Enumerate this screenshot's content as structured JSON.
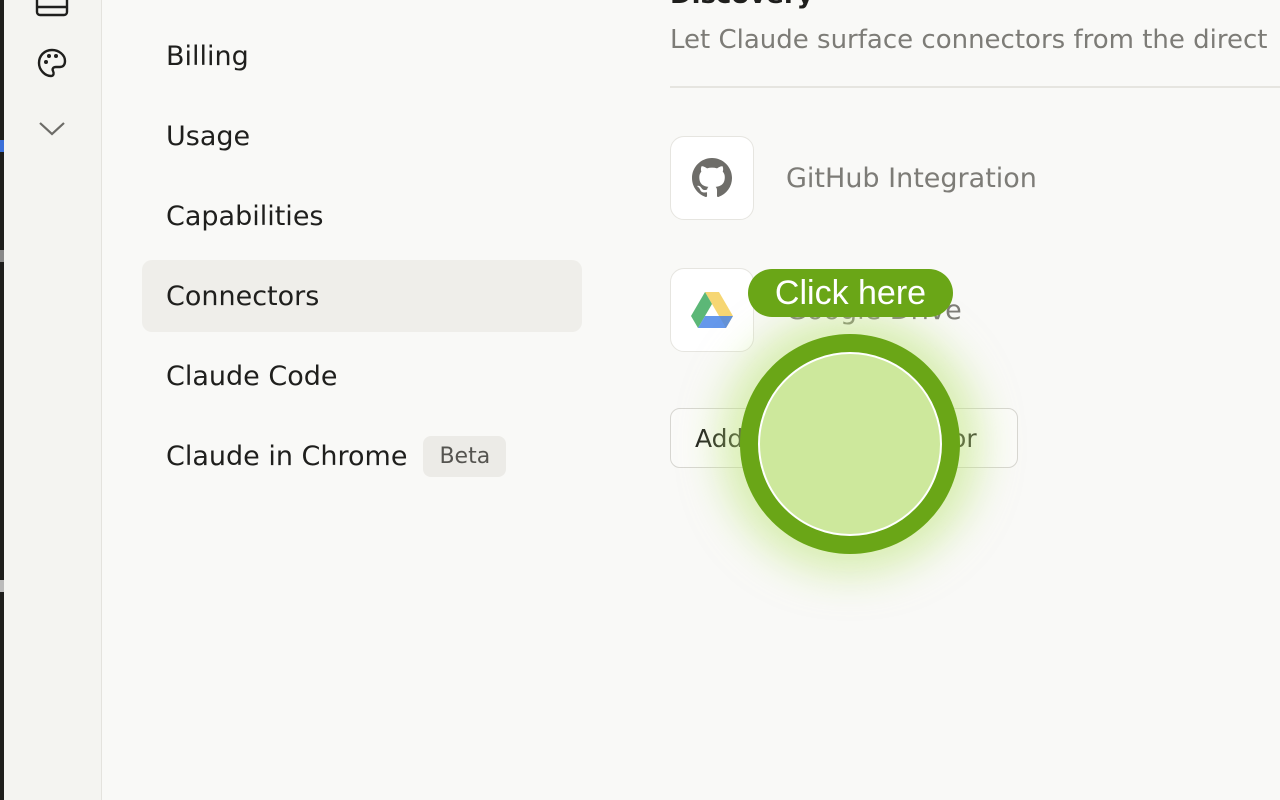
{
  "nav": {
    "items": [
      {
        "label": "Billing"
      },
      {
        "label": "Usage"
      },
      {
        "label": "Capabilities"
      },
      {
        "label": "Connectors"
      },
      {
        "label": "Claude Code"
      },
      {
        "label": "Claude in Chrome",
        "badge": "Beta"
      }
    ],
    "active": "Connectors"
  },
  "main": {
    "section_title": "Discovery",
    "section_description": "Let Claude surface connectors from the direct",
    "connectors": [
      {
        "name": "GitHub Integration",
        "icon": "github-icon"
      },
      {
        "name": "Google Drive",
        "icon": "google-drive-icon"
      }
    ],
    "add_button_label": "Add custom connector"
  },
  "overlay": {
    "hint_label": "Click here"
  },
  "colors": {
    "background": "#f9f9f7",
    "active_nav": "#efeeea",
    "hint_green": "#6aa617",
    "muted_text": "#7d7c77"
  }
}
